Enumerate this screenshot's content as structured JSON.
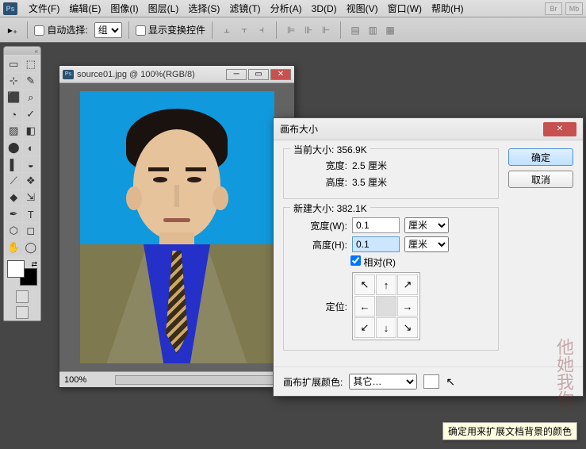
{
  "menu": {
    "file": "文件(F)",
    "edit": "编辑(E)",
    "image": "图像(I)",
    "layer": "图层(L)",
    "select": "选择(S)",
    "filter": "滤镜(T)",
    "analysis": "分析(A)",
    "three": "3D(D)",
    "view": "视图(V)",
    "window": "窗口(W)",
    "help": "帮助(H)",
    "br": "Br",
    "mb": "Mb"
  },
  "opts": {
    "auto": "自动选择:",
    "grpsel": "组",
    "show": "显示变换控件"
  },
  "doc": {
    "title": "source01.jpg @ 100%(RGB/8)",
    "zoom": "100%"
  },
  "dlg": {
    "title": "画布大小",
    "ok": "确定",
    "cancel": "取消",
    "cur": {
      "leg": "当前大小: 356.9K",
      "wl": "宽度:",
      "wv": "2.5 厘米",
      "hl": "高度:",
      "hv": "3.5 厘米"
    },
    "new": {
      "leg": "新建大小: 382.1K",
      "wl": "宽度(W):",
      "wv": "0.1",
      "hl": "高度(H):",
      "hv": "0.1",
      "unit": "厘米",
      "rel": "相对(R)",
      "anchor": "定位:"
    },
    "ext": {
      "lbl": "画布扩展颜色:",
      "sel": "其它…"
    }
  },
  "tooltip": "确定用来扩展文档背景的颜色",
  "tools": [
    "▭",
    "⬚",
    "⊹",
    "✎",
    "⬛",
    "⌕",
    "◔",
    "✓",
    "▨",
    "◧",
    "⬤",
    "◐",
    "▌",
    "◒",
    "⟋",
    "❖",
    "◆",
    "⇲",
    "✒",
    "T",
    "⬡",
    "◻",
    "✋",
    "◯"
  ]
}
